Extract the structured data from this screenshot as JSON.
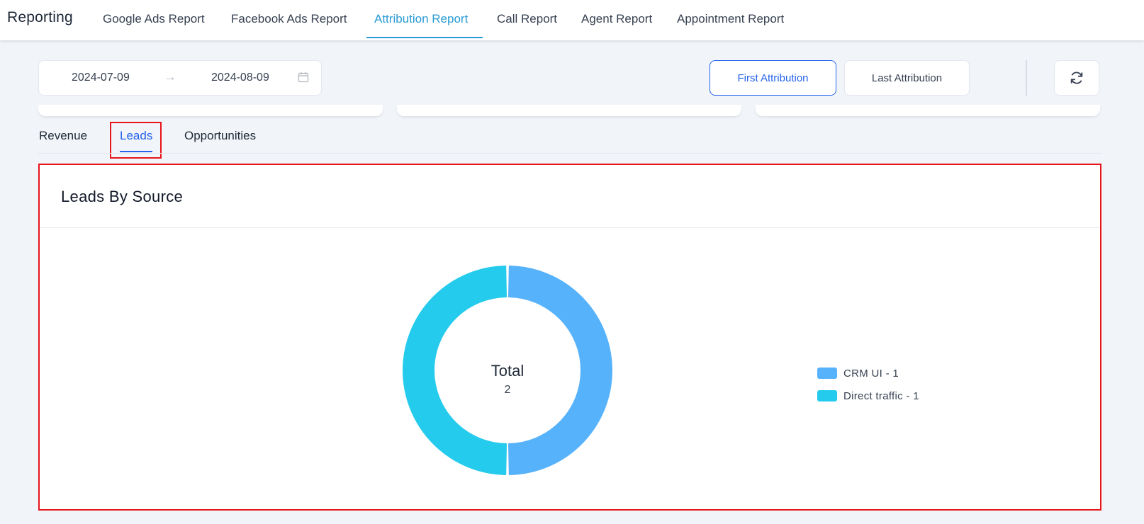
{
  "app": {
    "title": "Reporting"
  },
  "nav": {
    "items": [
      {
        "label": "Google Ads Report"
      },
      {
        "label": "Facebook Ads Report"
      },
      {
        "label": "Attribution Report"
      },
      {
        "label": "Call Report"
      },
      {
        "label": "Agent Report"
      },
      {
        "label": "Appointment Report"
      }
    ],
    "active_index": 2,
    "active_color": "#2a9bd5"
  },
  "toolbar": {
    "date_from": "2024-07-09",
    "date_arrow": "→",
    "date_to": "2024-08-09",
    "calendar_icon": "calendar-icon",
    "first_attribution_label": "First Attribution",
    "last_attribution_label": "Last Attribution",
    "selected_attribution": "First Attribution",
    "refresh_icon": "refresh-icon"
  },
  "subtabs": {
    "items": [
      {
        "label": "Revenue"
      },
      {
        "label": "Leads"
      },
      {
        "label": "Opportunities"
      }
    ],
    "active_index": 1,
    "highlight_color": "#e8141b"
  },
  "panel": {
    "title": "Leads By Source",
    "center_title": "Total",
    "center_value": "2"
  },
  "chart_data": {
    "type": "pie",
    "donut": true,
    "categories": [
      "CRM UI",
      "Direct traffic"
    ],
    "values": [
      1,
      1
    ],
    "colors": [
      "#56b2fb",
      "#25cbec"
    ],
    "legend": [
      "CRM UI - 1",
      "Direct traffic - 1"
    ],
    "legend_placement": "right",
    "center_label": "Total",
    "total": 2
  }
}
